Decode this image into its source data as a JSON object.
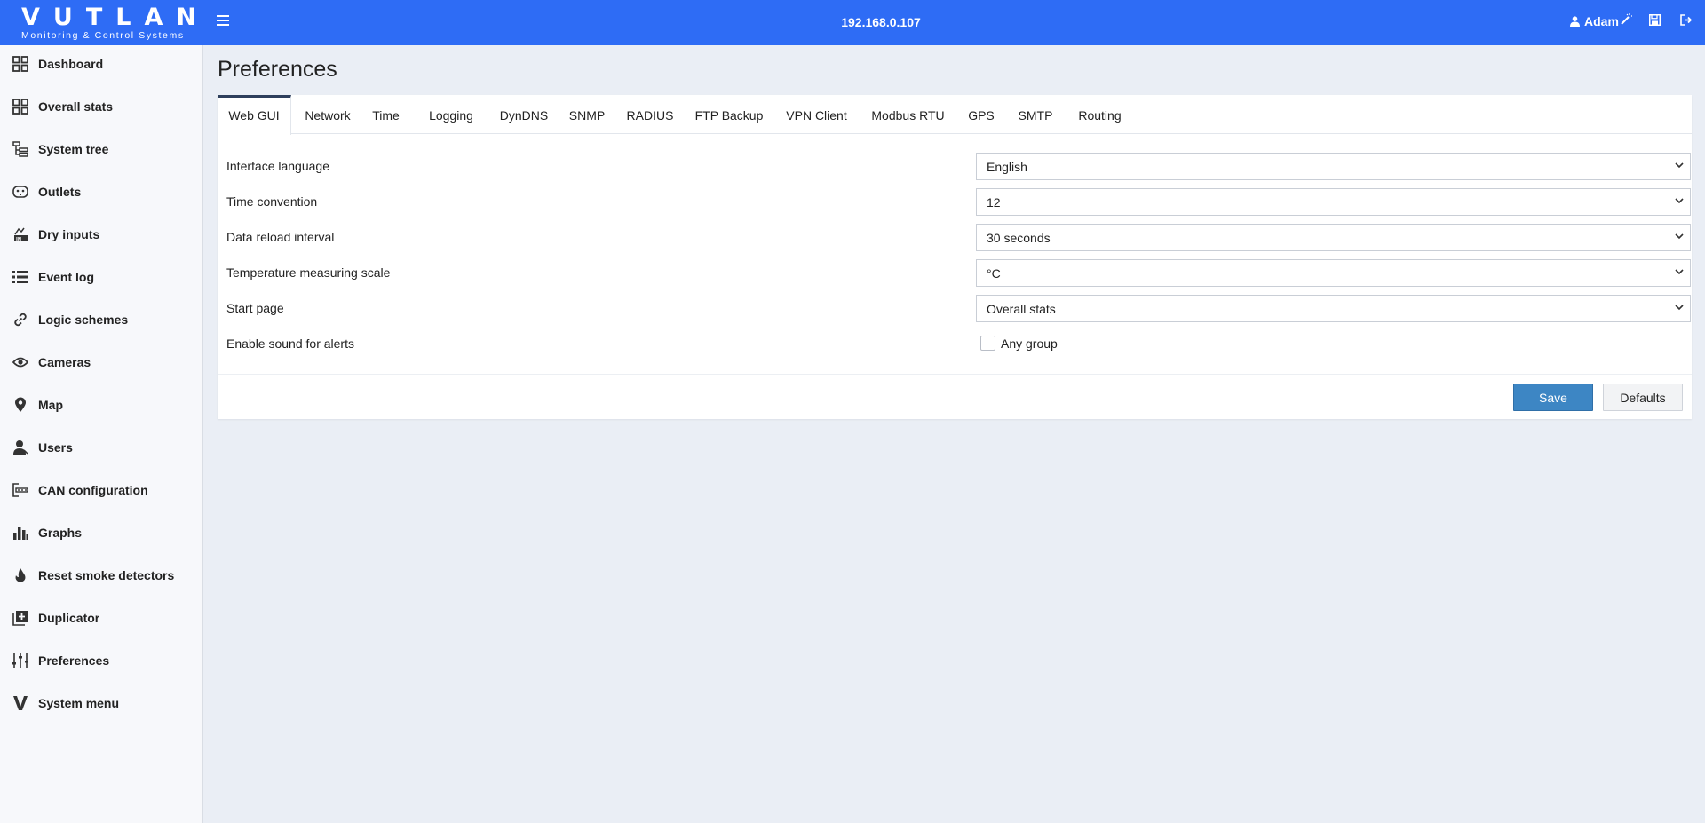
{
  "header": {
    "logo_title": "VUTLAN",
    "logo_subtitle": "Monitoring & Control Systems",
    "ip": "192.168.0.107",
    "user": "Adam",
    "icons": [
      "menu-icon",
      "magic-wand-icon",
      "user-icon",
      "save-icon",
      "logout-icon"
    ],
    "color": "#2e6cf5"
  },
  "sidebar": {
    "items": [
      {
        "label": "Dashboard",
        "icon": "dashboard-icon"
      },
      {
        "label": "Overall stats",
        "icon": "grid-icon"
      },
      {
        "label": "System tree",
        "icon": "tree-icon"
      },
      {
        "label": "Outlets",
        "icon": "outlet-icon"
      },
      {
        "label": "Dry inputs",
        "icon": "dry-input-icon"
      },
      {
        "label": "Event log",
        "icon": "list-icon"
      },
      {
        "label": "Logic schemes",
        "icon": "link-icon"
      },
      {
        "label": "Cameras",
        "icon": "eye-icon"
      },
      {
        "label": "Map",
        "icon": "map-pin-icon"
      },
      {
        "label": "Users",
        "icon": "users-icon"
      },
      {
        "label": "CAN configuration",
        "icon": "can-icon"
      },
      {
        "label": "Graphs",
        "icon": "bar-chart-icon"
      },
      {
        "label": "Reset smoke detectors",
        "icon": "flame-icon"
      },
      {
        "label": "Duplicator",
        "icon": "duplicate-icon"
      },
      {
        "label": "Preferences",
        "icon": "sliders-icon"
      },
      {
        "label": "System menu",
        "icon": "v-logo-icon"
      }
    ]
  },
  "main": {
    "title": "Preferences",
    "tabs": [
      "Web GUI",
      "Network",
      "Time",
      "Logging",
      "DynDNS",
      "SNMP",
      "RADIUS",
      "FTP Backup",
      "VPN Client",
      "Modbus RTU",
      "GPS",
      "SMTP",
      "Routing"
    ],
    "active_tab": "Web GUI",
    "fields": [
      {
        "label": "Interface language",
        "value": "English"
      },
      {
        "label": "Time convention",
        "value": "12"
      },
      {
        "label": "Data reload interval",
        "value": "30 seconds"
      },
      {
        "label": "Temperature measuring scale",
        "value": "°C"
      },
      {
        "label": "Start page",
        "value": "Overall stats"
      }
    ],
    "sound": {
      "label": "Enable sound for alerts",
      "checkbox_label": "Any group",
      "checked": false
    },
    "buttons": {
      "save": "Save",
      "defaults": "Defaults"
    },
    "accent": "#3d86c4"
  }
}
